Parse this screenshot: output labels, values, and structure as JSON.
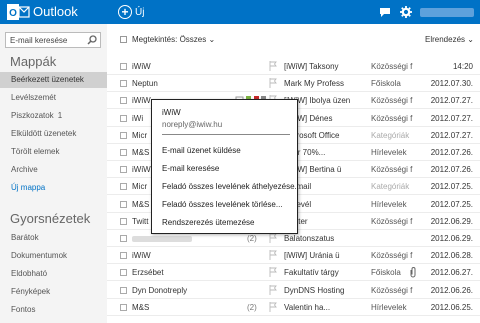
{
  "app": {
    "title": "Outlook",
    "new_label": "Új"
  },
  "sidebar": {
    "search_placeholder": "E-mail keresése",
    "folders_heading": "Mappák",
    "folders": [
      {
        "label": "Beérkezett üzenetek",
        "count": ""
      },
      {
        "label": "Levélszemét",
        "count": ""
      },
      {
        "label": "Piszkozatok",
        "count": "1"
      },
      {
        "label": "Elküldött üzenetek",
        "count": ""
      },
      {
        "label": "Törölt elemek",
        "count": ""
      },
      {
        "label": "Archive",
        "count": ""
      }
    ],
    "new_folder": "Új mappa",
    "quick_heading": "Gyorsnézetek",
    "quick_views": [
      "Barátok",
      "Dokumentumok",
      "Eldobható",
      "Fényképek",
      "Fontos"
    ]
  },
  "toolbar": {
    "sort_label": "Megtekintés: Összes",
    "order_label": "Elrendezés"
  },
  "messages": [
    {
      "from": "iWiW",
      "subject": "[iWiW] Taksony",
      "folder": "Közösségi f",
      "date": "14:20",
      "muted": false
    },
    {
      "from": "Neptun",
      "subject": "Mark My Profess",
      "folder": "Főiskola",
      "date": "2012.07.30.",
      "muted": false
    },
    {
      "from": "iWiW",
      "subject": "[iWiW] Ibolya üzen",
      "folder": "Közösségi f",
      "date": "2012.07.27.",
      "muted": false
    },
    {
      "from": "iWi",
      "subject": "[iWiW] Dénes",
      "folder": "Közösségi f",
      "date": "2012.07.27.",
      "muted": false
    },
    {
      "from": "Micr",
      "subject": "Microsoft Office",
      "folder": "Kategóriák",
      "date": "2012.07.27.",
      "muted": true
    },
    {
      "from": "M&S",
      "subject": "Akár 70%...",
      "folder": "Hírlevelek",
      "date": "2012.07.26.",
      "muted": false
    },
    {
      "from": "iWiW",
      "subject": "[iWiW] Bertina ü",
      "folder": "Közösségi f",
      "date": "2012.07.26.",
      "muted": false
    },
    {
      "from": "Micr",
      "subject": "Hotmail",
      "folder": "Kategóriák",
      "date": "2012.07.25.",
      "muted": true
    },
    {
      "from": "M&S",
      "subject": "Hírlevél",
      "folder": "Hírlevelek",
      "date": "2012.07.25.",
      "muted": false
    },
    {
      "from": "Twitt",
      "subject": "Twitter",
      "folder": "Közösségi f",
      "date": "2012.06.29.",
      "muted": false
    },
    {
      "from": "",
      "thread": "(2)",
      "subject": "Balatonszatus",
      "folder": "",
      "date": "2012.06.29.",
      "muted": false
    },
    {
      "from": "iWiW",
      "subject": "[iWiW] Uránia ü",
      "folder": "Közösségi f",
      "date": "2012.06.28.",
      "muted": false
    },
    {
      "from": "Erzsébet",
      "subject": "Fakultatív tárgy",
      "folder": "Főiskola",
      "date": "2012.06.27.",
      "muted": false
    },
    {
      "from": "Dyn Donotreply",
      "subject": "DynDNS Hosting",
      "folder": "Közösségi f",
      "date": "2012.06.26.",
      "muted": false
    },
    {
      "from": "M&S",
      "thread": "(2)",
      "subject": "Valentin ha...",
      "folder": "Hírlevelek",
      "date": "2012.06.25.",
      "muted": false
    }
  ],
  "context_menu": {
    "name": "iWiW",
    "email": "noreply@iwiw.hu",
    "items": [
      "E-mail üzenet küldése",
      "E-mail keresése",
      "Feladó összes levelének áthelyezése...",
      "Feladó összes levelének törlése...",
      "Rendszerezés ütemezése"
    ]
  },
  "colors": {
    "brand": "#0072c6",
    "sidebar_bg": "#f4f4f4",
    "selected_bg": "#d0d0d0"
  }
}
